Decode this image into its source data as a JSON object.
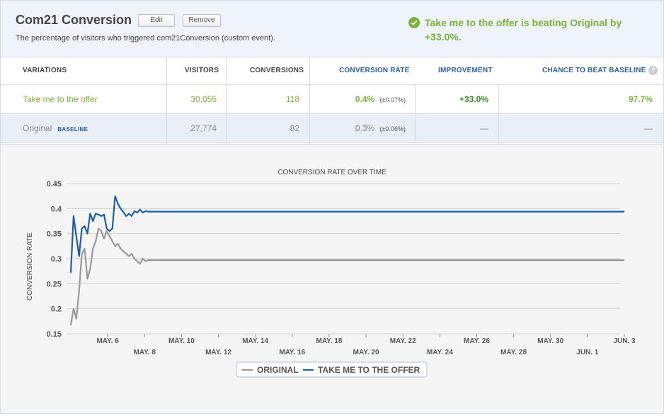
{
  "header": {
    "title": "Com21 Conversion",
    "edit_label": "Edit",
    "remove_label": "Remove",
    "description": "The percentage of visitors who triggered com21Conversion (custom event).",
    "winner_message": "Take me to the offer is beating Original by +33.0%.",
    "winner_icon": "check-circle-icon",
    "accent_color": "#7eb03c"
  },
  "table": {
    "columns": {
      "variations": "VARIATIONS",
      "visitors": "VISITORS",
      "conversions": "CONVERSIONS",
      "conversion_rate": "CONVERSION RATE",
      "improvement": "IMPROVEMENT",
      "chance": "CHANCE TO BEAT BASELINE"
    },
    "help_icon": "question-circle-icon",
    "rows": [
      {
        "name": "Take me to the offer",
        "baseline_tag": "",
        "visitors": "30,055",
        "conversions": "118",
        "rate": "0.4%",
        "rate_interval": "(±0.07%)",
        "improvement": "+33.0%",
        "chance": "97.7%"
      },
      {
        "name": "Original",
        "baseline_tag": "BASELINE",
        "visitors": "27,774",
        "conversions": "82",
        "rate": "0.3%",
        "rate_interval": "(±0.06%)",
        "improvement": "—",
        "chance": "—"
      }
    ]
  },
  "chart_data": {
    "type": "line",
    "title": "CONVERSION RATE OVER TIME",
    "ylabel": "CONVERSION RATE",
    "xlabel": "",
    "ylim": [
      0.15,
      0.45
    ],
    "yticks": [
      "0.45",
      "0.4",
      "0.35",
      "0.3",
      "0.25",
      "0.2",
      "0.15"
    ],
    "xticks_upper": [
      "MAY. 6",
      "MAY. 10",
      "MAY. 14",
      "MAY. 18",
      "MAY. 22",
      "MAY. 26",
      "MAY. 30",
      "JUN. 3"
    ],
    "xticks_lower": [
      "MAY. 8",
      "MAY. 12",
      "MAY. 16",
      "MAY. 20",
      "MAY. 24",
      "MAY. 28",
      "JUN. 1"
    ],
    "xrange_days": [
      4,
      34
    ],
    "grid": true,
    "legend_position": "bottom-center",
    "series": [
      {
        "name": "ORIGINAL",
        "color": "#999999",
        "points": [
          [
            4.0,
            0.167
          ],
          [
            4.15,
            0.2
          ],
          [
            4.3,
            0.18
          ],
          [
            4.45,
            0.235
          ],
          [
            4.6,
            0.31
          ],
          [
            4.75,
            0.32
          ],
          [
            4.9,
            0.26
          ],
          [
            5.05,
            0.28
          ],
          [
            5.2,
            0.32
          ],
          [
            5.35,
            0.335
          ],
          [
            5.5,
            0.36
          ],
          [
            5.65,
            0.355
          ],
          [
            5.8,
            0.34
          ],
          [
            5.95,
            0.355
          ],
          [
            6.1,
            0.345
          ],
          [
            6.25,
            0.335
          ],
          [
            6.4,
            0.325
          ],
          [
            6.55,
            0.33
          ],
          [
            6.7,
            0.32
          ],
          [
            6.85,
            0.315
          ],
          [
            7.0,
            0.31
          ],
          [
            7.15,
            0.305
          ],
          [
            7.3,
            0.31
          ],
          [
            7.45,
            0.3
          ],
          [
            7.6,
            0.295
          ],
          [
            7.75,
            0.29
          ],
          [
            7.9,
            0.3
          ],
          [
            8.05,
            0.295
          ],
          [
            8.2,
            0.297
          ],
          [
            34.0,
            0.297
          ]
        ]
      },
      {
        "name": "TAKE ME TO THE OFFER",
        "color": "#1f5ea8",
        "points": [
          [
            4.0,
            0.272
          ],
          [
            4.15,
            0.385
          ],
          [
            4.3,
            0.345
          ],
          [
            4.45,
            0.305
          ],
          [
            4.6,
            0.36
          ],
          [
            4.75,
            0.365
          ],
          [
            4.9,
            0.35
          ],
          [
            5.05,
            0.39
          ],
          [
            5.2,
            0.375
          ],
          [
            5.35,
            0.39
          ],
          [
            5.5,
            0.388
          ],
          [
            5.65,
            0.385
          ],
          [
            5.8,
            0.388
          ],
          [
            5.95,
            0.36
          ],
          [
            6.1,
            0.355
          ],
          [
            6.25,
            0.36
          ],
          [
            6.4,
            0.425
          ],
          [
            6.55,
            0.41
          ],
          [
            6.7,
            0.4
          ],
          [
            6.85,
            0.393
          ],
          [
            7.0,
            0.385
          ],
          [
            7.15,
            0.39
          ],
          [
            7.3,
            0.385
          ],
          [
            7.45,
            0.395
          ],
          [
            7.6,
            0.392
          ],
          [
            7.75,
            0.398
          ],
          [
            7.9,
            0.392
          ],
          [
            8.05,
            0.395
          ],
          [
            8.2,
            0.394
          ],
          [
            34.0,
            0.394
          ]
        ]
      }
    ]
  }
}
